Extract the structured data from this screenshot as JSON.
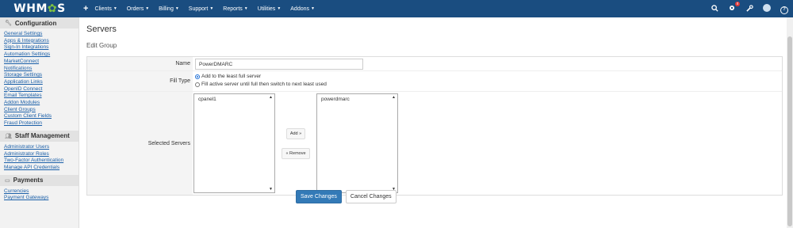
{
  "brand": {
    "logo_text_left": "WHM",
    "logo_text_mid": "✿",
    "logo_text_right": "S"
  },
  "topnav": {
    "plus": "+",
    "items": [
      {
        "label": "Clients"
      },
      {
        "label": "Orders"
      },
      {
        "label": "Billing"
      },
      {
        "label": "Support"
      },
      {
        "label": "Reports"
      },
      {
        "label": "Utilities"
      },
      {
        "label": "Addons"
      }
    ],
    "icons": [
      "search-icon",
      "gear-icon",
      "wrench-icon",
      "user-icon",
      "help-icon"
    ],
    "notification_badge": "x"
  },
  "sidebar": {
    "sections": [
      {
        "title": "Configuration",
        "icon": "wrench-icon",
        "links": [
          "General Settings",
          "Apps & Integrations",
          "Sign-In Integrations",
          "Automation Settings",
          "MarketConnect",
          "Notifications",
          "Storage Settings",
          "Application Links",
          "OpenID Connect",
          "Email Templates",
          "Addon Modules",
          "Client Groups",
          "Custom Client Fields",
          "Fraud Protection"
        ]
      },
      {
        "title": "Staff Management",
        "icon": "users-icon",
        "links": [
          "Administrator Users",
          "Administrator Roles",
          "Two-Factor Authentication",
          "Manage API Credentials"
        ]
      },
      {
        "title": "Payments",
        "icon": "card-icon",
        "links": [
          "Currencies",
          "Payment Gateways"
        ]
      }
    ]
  },
  "main": {
    "title": "Servers",
    "subtitle": "Edit Group",
    "form": {
      "name_label": "Name",
      "name_value": "PowerDMARC",
      "fill_type_label": "Fill Type",
      "fill_options": [
        {
          "label": "Add to the least full server",
          "selected": true
        },
        {
          "label": "Fill active server until full then switch to next least used",
          "selected": false
        }
      ],
      "selected_servers_label": "Selected Servers",
      "available_servers": [
        "cpanel1"
      ],
      "selected_servers": [
        "powerdmarc"
      ],
      "add_label": "Add »",
      "remove_label": "« Remove"
    },
    "actions": {
      "save_label": "Save Changes",
      "cancel_label": "Cancel Changes"
    }
  },
  "colors": {
    "topbar": "#1a4d80",
    "primary_button": "#337ab7",
    "link": "#1a5fa8",
    "logo_accent": "#7fc241"
  }
}
